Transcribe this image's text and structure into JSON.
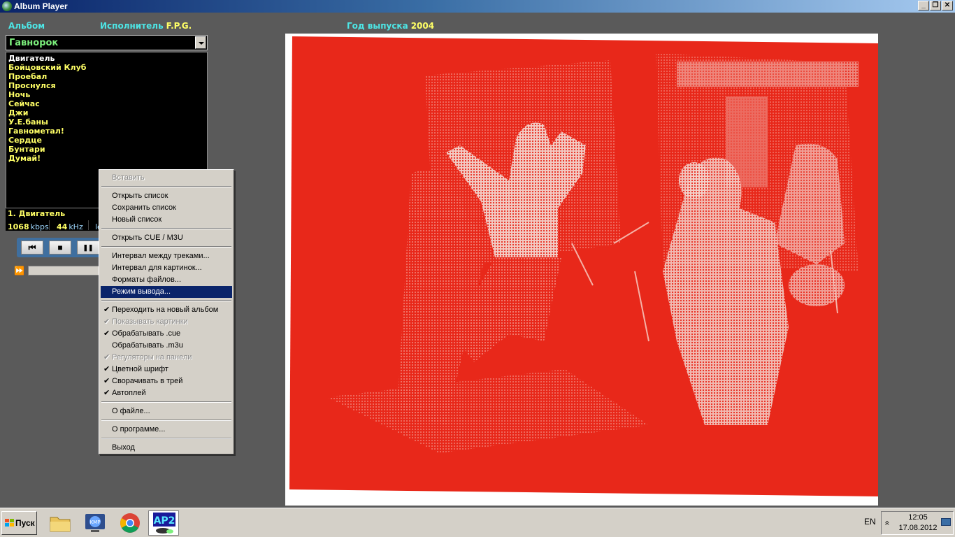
{
  "window": {
    "title": "Album Player"
  },
  "window_controls": {
    "minimize": "_",
    "maximize": "❐",
    "close": "✕"
  },
  "header": {
    "album_label": "Альбом",
    "artist_label": "Исполнитель",
    "artist_value": "F.P.G.",
    "year_label": "Год выпуска",
    "year_value": "2004"
  },
  "album_select": {
    "value": "Гавнорок"
  },
  "tracks": [
    "Двигатель",
    "Бойцовский Клуб",
    "Проебал",
    "Проснулся",
    "Ночь",
    "Сейчас",
    "Джи",
    "У.Е.баны",
    "Гавнометал!",
    "Сердце",
    "Бунтари",
    "Думай!"
  ],
  "now_playing": "1.   Двигатель",
  "info": {
    "bitrate": "1068",
    "bitrate_unit": "kbps",
    "samplerate": "44",
    "samplerate_unit": "kHz",
    "partial": "le"
  },
  "transport": {
    "prev": "⏮",
    "stop": "■",
    "pause": "❚❚"
  },
  "seek": {
    "ffw_icon": "⏩"
  },
  "colors": {
    "label_cyan": "#4de6e6",
    "value_yellow": "#ffff66",
    "album_green": "#7cf07c",
    "art_red": "#e8281a",
    "menu_highlight": "#0a246a"
  },
  "context_menu": [
    {
      "label": "Вставить",
      "disabled": true
    },
    {
      "sep": true
    },
    {
      "label": "Открыть список"
    },
    {
      "label": "Сохранить список"
    },
    {
      "label": "Новый список"
    },
    {
      "sep": true
    },
    {
      "label": "Открыть CUE / M3U"
    },
    {
      "sep": true
    },
    {
      "label": "Интервал между треками..."
    },
    {
      "label": "Интервал для картинок..."
    },
    {
      "label": "Форматы файлов..."
    },
    {
      "label": "Режим вывода...",
      "highlighted": true
    },
    {
      "sep": true
    },
    {
      "label": "Переходить на новый альбом",
      "checked": true
    },
    {
      "label": "Показывать картинки",
      "checked": true,
      "disabled": true
    },
    {
      "label": "Обрабатывать .cue",
      "checked": true
    },
    {
      "label": "Обрабатывать .m3u"
    },
    {
      "label": "Регуляторы на панели",
      "checked": true,
      "disabled": true
    },
    {
      "label": "Цветной шрифт",
      "checked": true
    },
    {
      "label": "Сворачивать в трей",
      "checked": true
    },
    {
      "label": "Автоплей",
      "checked": true
    },
    {
      "sep": true
    },
    {
      "label": "О файле..."
    },
    {
      "sep": true
    },
    {
      "label": "О программе..."
    },
    {
      "sep": true
    },
    {
      "label": "Выход"
    }
  ],
  "taskbar": {
    "start_label": "Пуск",
    "apps": [
      "folder-icon",
      "kmplayer-icon",
      "chrome-icon",
      "album-player-icon"
    ],
    "kmp_label": "KMP",
    "ap2_label": "AP2",
    "lang": "EN",
    "tray_chevron": "«",
    "time": "12:05",
    "date": "17.08.2012"
  }
}
